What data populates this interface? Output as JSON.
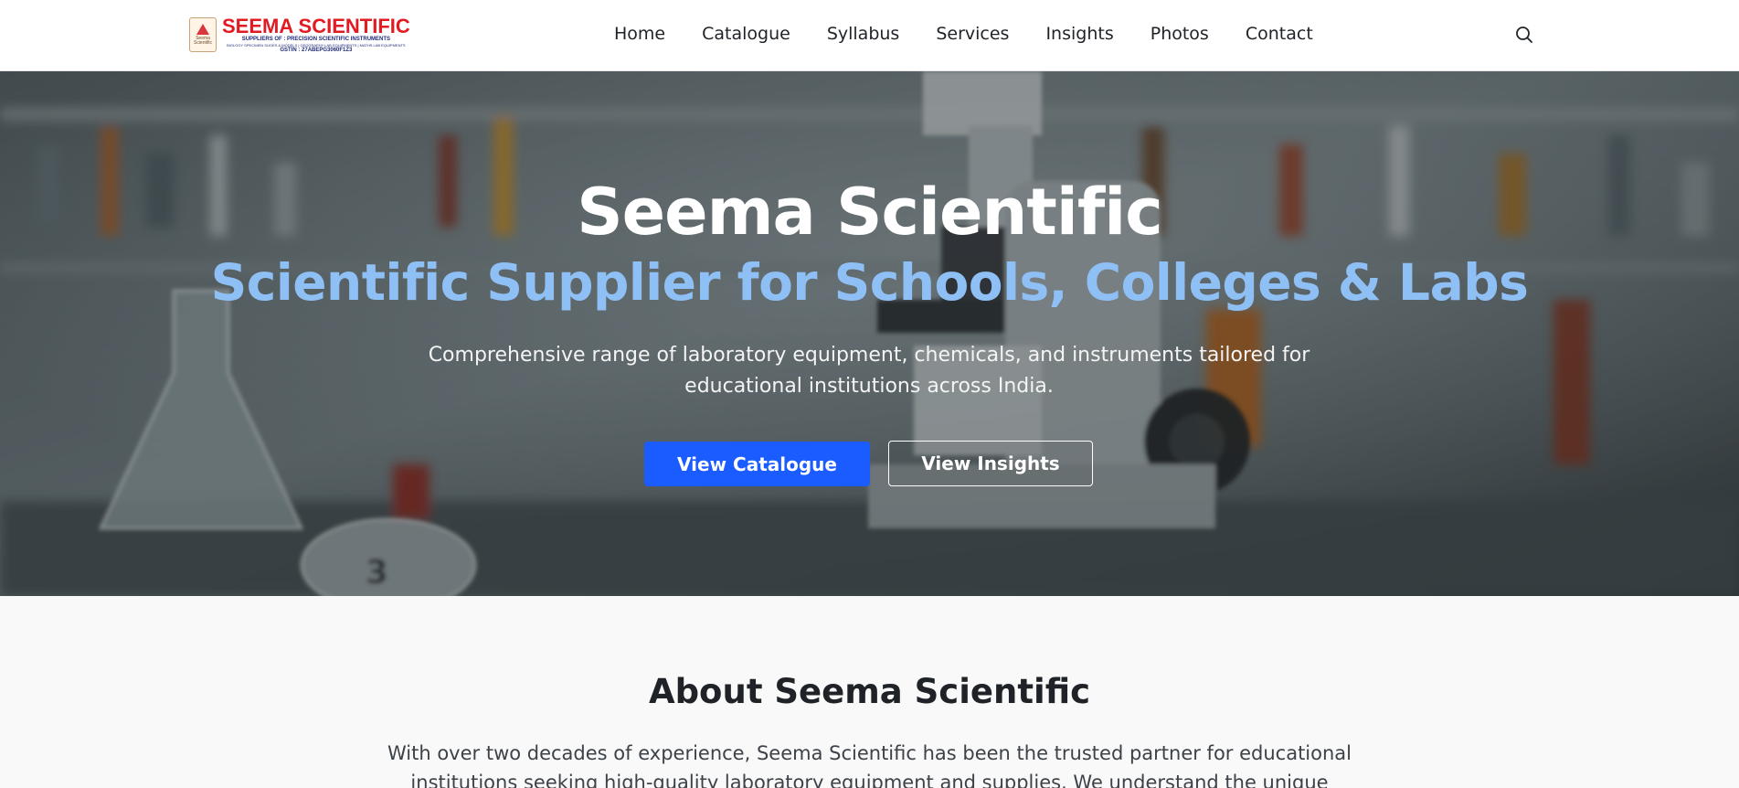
{
  "header": {
    "logo": {
      "title": "SEEMA SCIENTIFIC",
      "tagline": "SUPPLIERS OF : PRECISION SCIENTIFIC INSTRUMENTS",
      "tagline2": "BIOLOGY SPECIMEN SLIDES & MODELS | GEOGRAPHY LAB EQUIPMENTS | MATHS LAB EQUIPMENTS",
      "gstin": "GSTIN : 27ABEPG3060F1Z3",
      "seal_text": "Seema Scientific"
    },
    "nav": [
      {
        "label": "Home"
      },
      {
        "label": "Catalogue"
      },
      {
        "label": "Syllabus"
      },
      {
        "label": "Services"
      },
      {
        "label": "Insights"
      },
      {
        "label": "Photos"
      },
      {
        "label": "Contact"
      }
    ],
    "search_icon": "search-icon"
  },
  "hero": {
    "title": "Seema Scientific",
    "subtitle": "Scientific Supplier for Schools, Colleges & Labs",
    "description": "Comprehensive range of laboratory equipment, chemicals, and instruments tailored for educational institutions across India.",
    "primary_button": "View Catalogue",
    "secondary_button": "View Insights"
  },
  "about": {
    "title": "About Seema Scientific",
    "text": "With over two decades of experience, Seema Scientific has been the trusted partner for educational institutions seeking high-quality laboratory equipment and supplies. We understand the unique"
  },
  "colors": {
    "brand_red": "#e21b23",
    "brand_navy": "#1e2a78",
    "accent_blue": "#1a5cff",
    "subtitle_blue": "#8fc0f5"
  }
}
